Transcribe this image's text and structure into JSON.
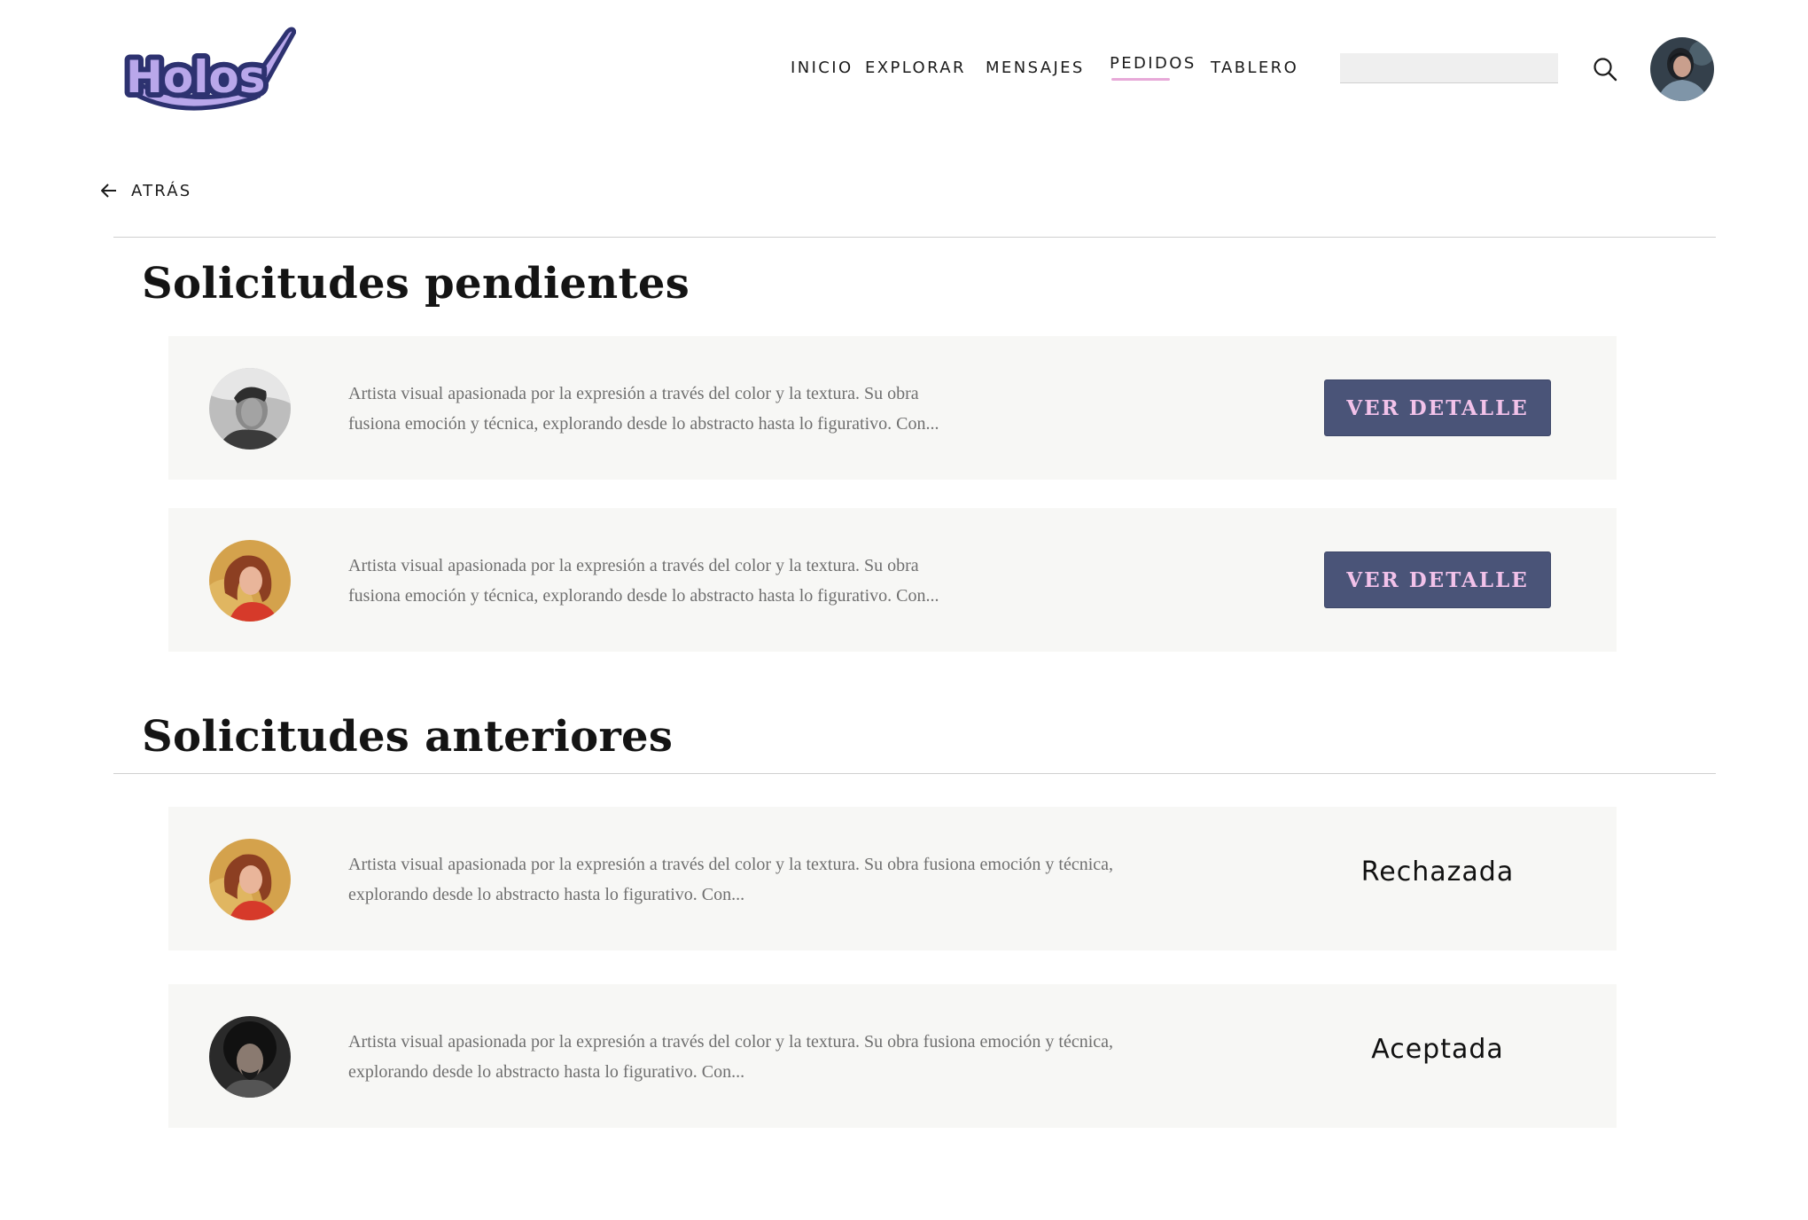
{
  "header": {
    "logo_text": "Holos",
    "nav": [
      {
        "label": "INICIO"
      },
      {
        "label": "EXPLORAR"
      },
      {
        "label": "MENSAJES"
      },
      {
        "label": "PEDIDOS",
        "active": true
      },
      {
        "label": "TABLERO"
      }
    ],
    "search": {
      "value": "",
      "placeholder": ""
    },
    "accent_color": "#e7a9d8"
  },
  "back": {
    "label": "ATRÁS"
  },
  "pending": {
    "title": "Solicitudes pendientes",
    "items": [
      {
        "avatar": "man-bw",
        "line1": "Artista visual apasionada por la expresión a través del color y la textura. Su obra",
        "line2": "fusiona emoción y técnica, explorando desde lo abstracto hasta lo figurativo. Con...",
        "button": "VER DETALLE"
      },
      {
        "avatar": "woman-redhead",
        "line1": "Artista visual apasionada por la expresión a través del color y la textura. Su obra",
        "line2": "fusiona emoción y técnica, explorando desde lo abstracto hasta lo figurativo. Con...",
        "button": "VER DETALLE"
      }
    ]
  },
  "previous": {
    "title": "Solicitudes anteriores",
    "items": [
      {
        "avatar": "woman-redhead",
        "line1": "Artista visual apasionada por la expresión a través del color y la textura. Su obra fusiona emoción y técnica,",
        "line2": "explorando desde lo abstracto hasta lo figurativo. Con...",
        "status": "Rechazada"
      },
      {
        "avatar": "man-curly",
        "line1": "Artista visual apasionada por la expresión a través del color y la textura. Su obra fusiona emoción y técnica,",
        "line2": "explorando desde lo abstracto hasta lo figurativo. Con...",
        "status": "Aceptada"
      }
    ]
  },
  "colors": {
    "button_bg": "#4a5478",
    "button_text": "#f2c2ea",
    "card_bg": "#f7f7f5",
    "logo_fill": "#b9a7ea",
    "logo_outline": "#2d3270"
  }
}
